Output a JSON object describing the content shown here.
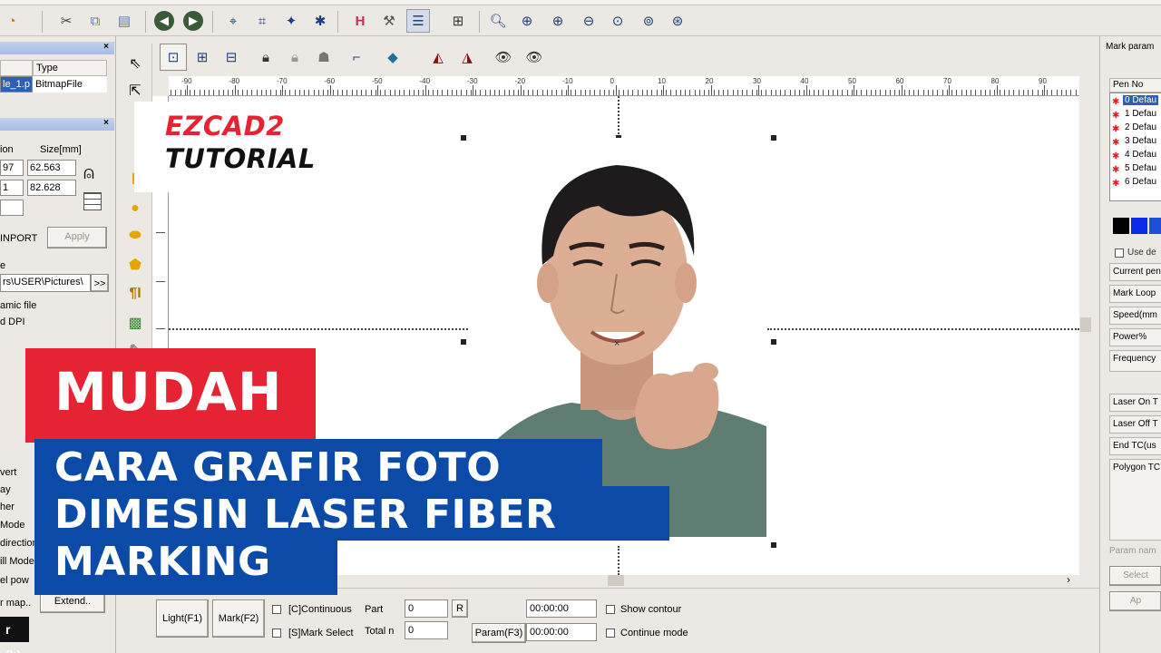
{
  "left_panel": {
    "object_list": {
      "header_col2": "Type",
      "row_name": "le_1.p",
      "row_type": "BitmapFile"
    },
    "size_panel": {
      "header_col1": "ion",
      "header_col2": "Size[mm]",
      "x_val": "97",
      "width_val": "62.563",
      "y_val": "1",
      "height_val": "82.628"
    },
    "inport_label": "INPORT",
    "apply_label": "Apply",
    "file_label": "e",
    "file_path": "rs\\USER\\Pictures\\",
    "browse_label": ">>",
    "dynamic_file": "amic file",
    "fixed_dpi": "d DPI",
    "opt1": "vert",
    "opt2": "ay",
    "opt3": "her",
    "opt4": "Mode",
    "opt5": "direction",
    "opt6": "ill Mode",
    "opt7": "el pow",
    "opt8": "r map..",
    "extend_label": "Extend.."
  },
  "ruler": {
    "labels": [
      "-90",
      "-80",
      "-70",
      "-60",
      "-50",
      "-40",
      "-30",
      "-20",
      "-10",
      "0",
      "10",
      "20",
      "30",
      "40",
      "50",
      "60",
      "70",
      "80",
      "90"
    ]
  },
  "right_panel": {
    "title": "Mark param",
    "pen_header": "Pen No",
    "pens": [
      "0 Defau",
      "1 Defau",
      "2 Defau",
      "3 Defau",
      "4 Defau",
      "5 Defau",
      "6 Defau"
    ],
    "colors": [
      "#000000",
      "#0a2ae8",
      "#e81010",
      "#1e4fd8"
    ],
    "use_default": "Use de",
    "fields": [
      "Current pen",
      "Mark Loop",
      "Speed(mm",
      "Power%",
      "Frequency",
      "Laser On T",
      "Laser Off T",
      "End TC(us",
      "Polygon TC"
    ],
    "param_name": "Param nam",
    "select_label": "Select",
    "apply_label": "Ap"
  },
  "bottom_bar": {
    "light_label": "Light(F1)",
    "mark_label": "Mark(F2)",
    "continuous_label": "[C]Continuous",
    "mark_select_label": "[S]Mark Select",
    "part_label": "Part",
    "part_value": "0",
    "r_label": "R",
    "total_label": "Total n",
    "total_value": "0",
    "time1": "00:00:00",
    "time2": "00:00:00",
    "param_label": "Param(F3)",
    "show_contour_label": "Show contour",
    "continue_mode_label": "Continue mode"
  },
  "overlay": {
    "brand_line1": "EZCAD2",
    "brand_line2": "TUTORIAL",
    "badge": "MUDAH",
    "title_lines": [
      "CARA GRAFIR FOTO",
      "DIMESIN LASER FIBER",
      "MARKING"
    ]
  },
  "corner_button": "r (k)",
  "colors": {
    "badge_red": "#e52332",
    "title_blue": "#0b4aa7",
    "brand_red": "#e52332"
  }
}
